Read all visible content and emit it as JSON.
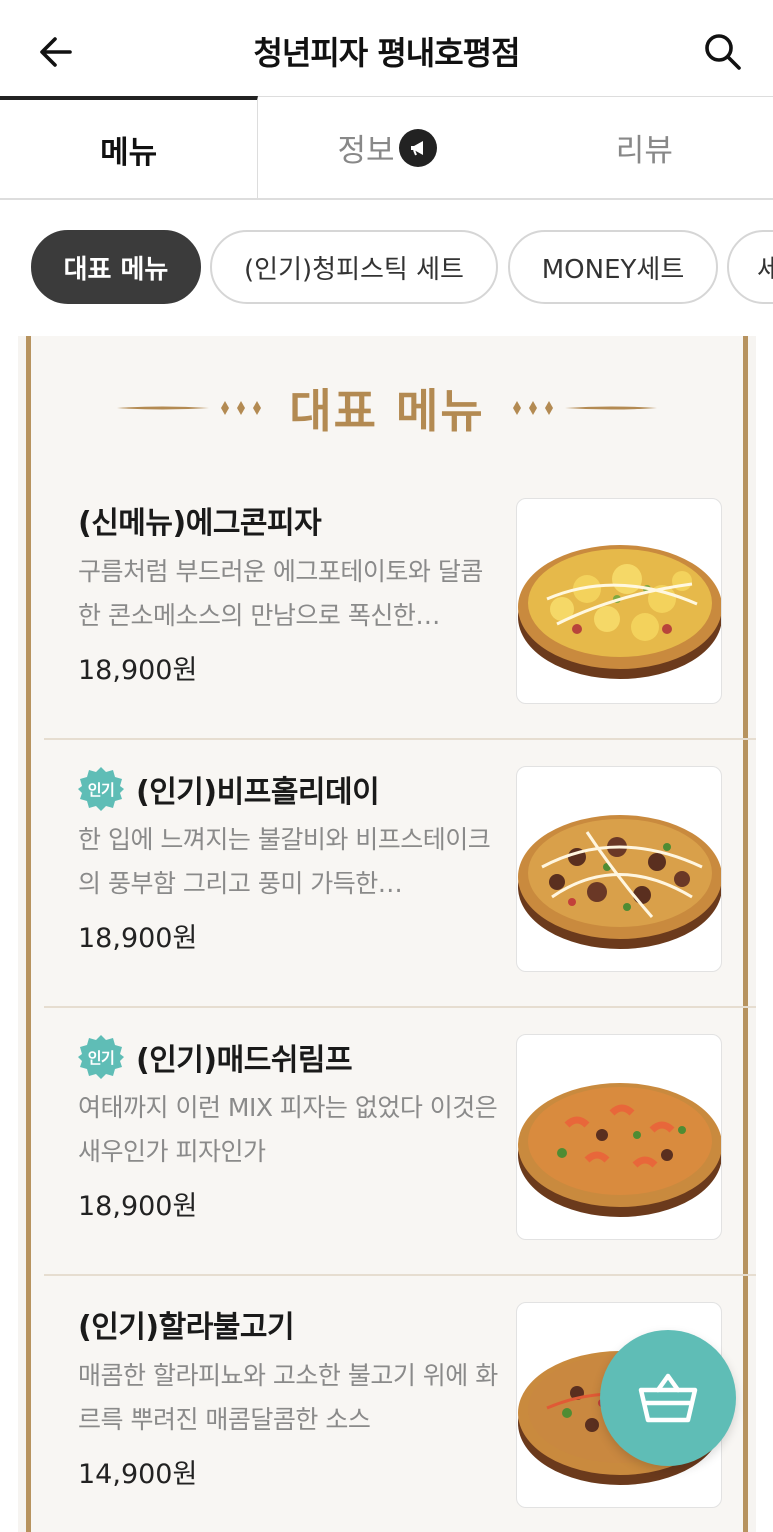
{
  "header": {
    "title": "청년피자 평내호평점",
    "back_icon": "back-arrow-icon",
    "search_icon": "search-icon"
  },
  "tabs": [
    {
      "label": "메뉴",
      "active": true
    },
    {
      "label": "정보",
      "active": false,
      "icon": "megaphone-icon"
    },
    {
      "label": "리뷰",
      "active": false
    }
  ],
  "chips": [
    {
      "label": "대표 메뉴",
      "active": true
    },
    {
      "label": "(인기)청피스틱 세트",
      "active": false
    },
    {
      "label": "MONEY세트",
      "active": false
    },
    {
      "label": "세",
      "active": false
    }
  ],
  "section": {
    "title": "대표 메뉴",
    "accent_color": "#b38a52"
  },
  "items": [
    {
      "name": "(신메뉴)에그콘피자",
      "badge": "",
      "description": "구름처럼 부드러운 에그포테이토와 달콤한 콘소메소스의 만남으로 폭신한…",
      "price": "18,900원"
    },
    {
      "name": "(인기)비프홀리데이",
      "badge": "인기",
      "description": "한 입에 느껴지는 불갈비와 비프스테이크의 풍부함 그리고 풍미 가득한…",
      "price": "18,900원"
    },
    {
      "name": "(인기)매드쉬림프",
      "badge": "인기",
      "description": "여태까지 이런 MIX 피자는 없었다 이것은 새우인가 피자인가",
      "price": "18,900원"
    },
    {
      "name": "(인기)할라불고기",
      "badge": "",
      "description": "매콤한 할라피뇨와 고소한 불고기 위에 화르륵 뿌려진 매콤달콤한 소스",
      "price": "14,900원"
    }
  ],
  "cart": {
    "icon": "basket-icon",
    "color": "#5fbdb6"
  }
}
